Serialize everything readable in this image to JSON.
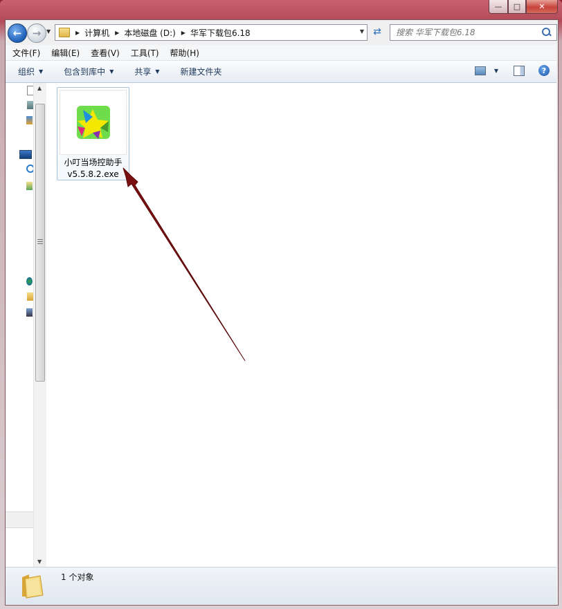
{
  "window": {
    "caption_min": "—",
    "caption_max": "□",
    "caption_close": "✕"
  },
  "address": {
    "crumbs": [
      "计算机",
      "本地磁盘 (D:)",
      "华军下载包6.18"
    ]
  },
  "search": {
    "placeholder": "搜索 华军下载包6.18"
  },
  "menu": {
    "items": [
      "文件(F)",
      "编辑(E)",
      "查看(V)",
      "工具(T)",
      "帮助(H)"
    ]
  },
  "toolbar": {
    "organize": "组织",
    "include_library": "包含到库中",
    "share": "共享",
    "new_folder": "新建文件夹"
  },
  "files": [
    {
      "name_line1": "小叮当场控助手",
      "name_line2": "v5.5.8.2.exe",
      "icon": "xiaodingdang-app-icon"
    }
  ],
  "status": {
    "count_text": "1 个对象"
  },
  "colors": {
    "titlebar": "#b24a58",
    "annotation_arrow": "#7b1010",
    "selection_border": "#a8c2dc"
  }
}
